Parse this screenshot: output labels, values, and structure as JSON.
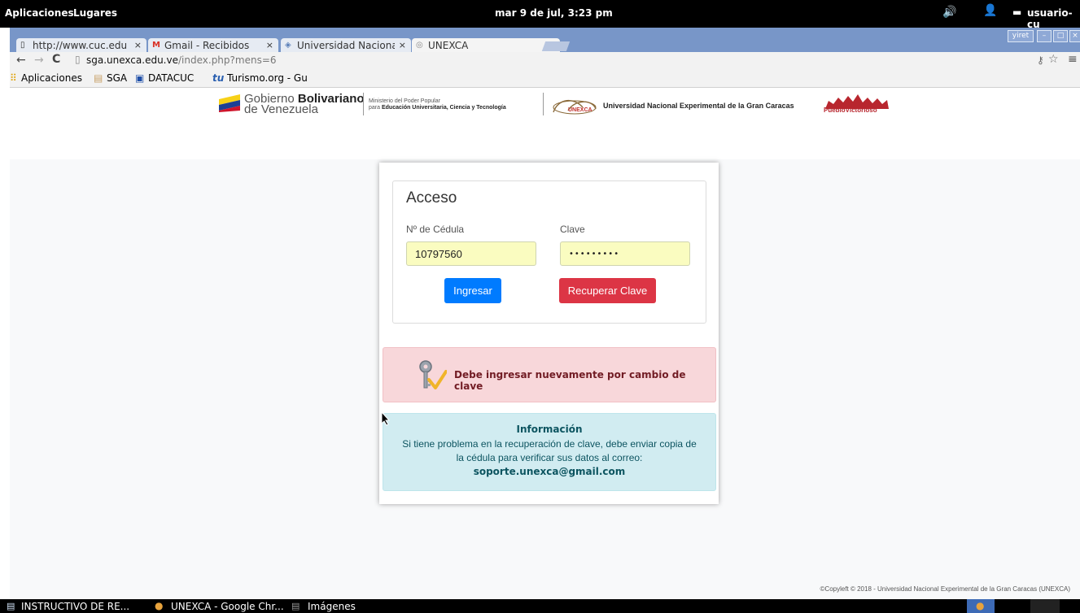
{
  "panel": {
    "apps_label": "Aplicaciones",
    "places_label": "Lugares",
    "datetime": "mar 9 de jul, 3:23 pm",
    "user": "usuario-cu"
  },
  "tabs": [
    {
      "label": "http://www.cuc.edu",
      "active": false
    },
    {
      "label": "Gmail - Recibidos",
      "active": false
    },
    {
      "label": "Universidad Nacional",
      "active": false
    },
    {
      "label": "UNEXCA",
      "active": true
    }
  ],
  "window_user": "yiret",
  "toolbar": {
    "url_host": "sga.unexca.edu.ve",
    "url_path": "/index.php?mens=6"
  },
  "bookmarks": [
    {
      "label": "Aplicaciones"
    },
    {
      "label": "SGA"
    },
    {
      "label": "DATACUC"
    },
    {
      "label": "Turismo.org - Gu"
    }
  ],
  "header": {
    "gob_line1_a": "Gobierno ",
    "gob_line1_b": "Bolivariano",
    "gob_line2": "de Venezuela",
    "min_line1": "Ministerio del Poder Popular",
    "min_line2_a": "para ",
    "min_line2_b": "Educación Universitaria, Ciencia y Tecnología",
    "unexca_mark": "UNEXCA",
    "university": "Universidad Nacional Experimental de la Gran Caracas",
    "pueblo": "PuebloVictorioso"
  },
  "form": {
    "title": "Acceso",
    "cedula_label": "Nº de Cédula",
    "cedula_value": "10797560",
    "clave_label": "Clave",
    "clave_value": "•••••••••",
    "login_button": "Ingresar",
    "recover_button": "Recuperar Clave"
  },
  "alert": {
    "message": "Debe ingresar nuevamente por cambio de clave"
  },
  "info": {
    "title": "Información",
    "line1": "Si tiene problema en la recuperación de clave, debe enviar copia de",
    "line2": "la cédula para verificar sus datos al correo:",
    "email": "soporte.unexca@gmail.com"
  },
  "footer": "©Copyleft © 2018 - Universidad Nacional Experimental de la Gran Caracas (UNEXCA)",
  "taskbar": [
    {
      "label": "INSTRUCTIVO DE RE..."
    },
    {
      "label": "UNEXCA - Google Chr..."
    },
    {
      "label": "Imágenes"
    }
  ],
  "colors": {
    "primary": "#007bff",
    "danger": "#dc3545",
    "alert_text": "#721c24",
    "info_text": "#0c5460"
  }
}
